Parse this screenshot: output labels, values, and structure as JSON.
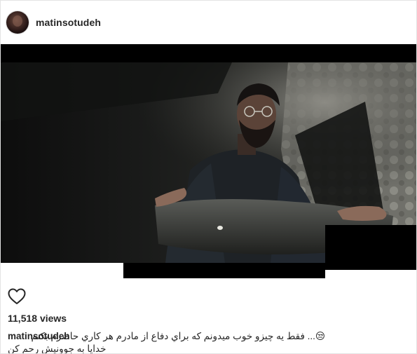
{
  "post": {
    "username": "matinsotudeh",
    "views": "11,518 views",
    "caption_user": "matinsotudeh",
    "caption_line1": "😒... فقط يه چيزو خوب ميدونم كه براي دفاع از مادرم هر كاري حاضرم بكنم",
    "caption_line2": "خدايا به جوونيش رحم كن"
  },
  "icons": {
    "avatar": "profile-avatar",
    "like": "heart-icon"
  },
  "colors": {
    "text": "#262626",
    "border": "#e3e3e3",
    "video_bg": "#000000"
  }
}
